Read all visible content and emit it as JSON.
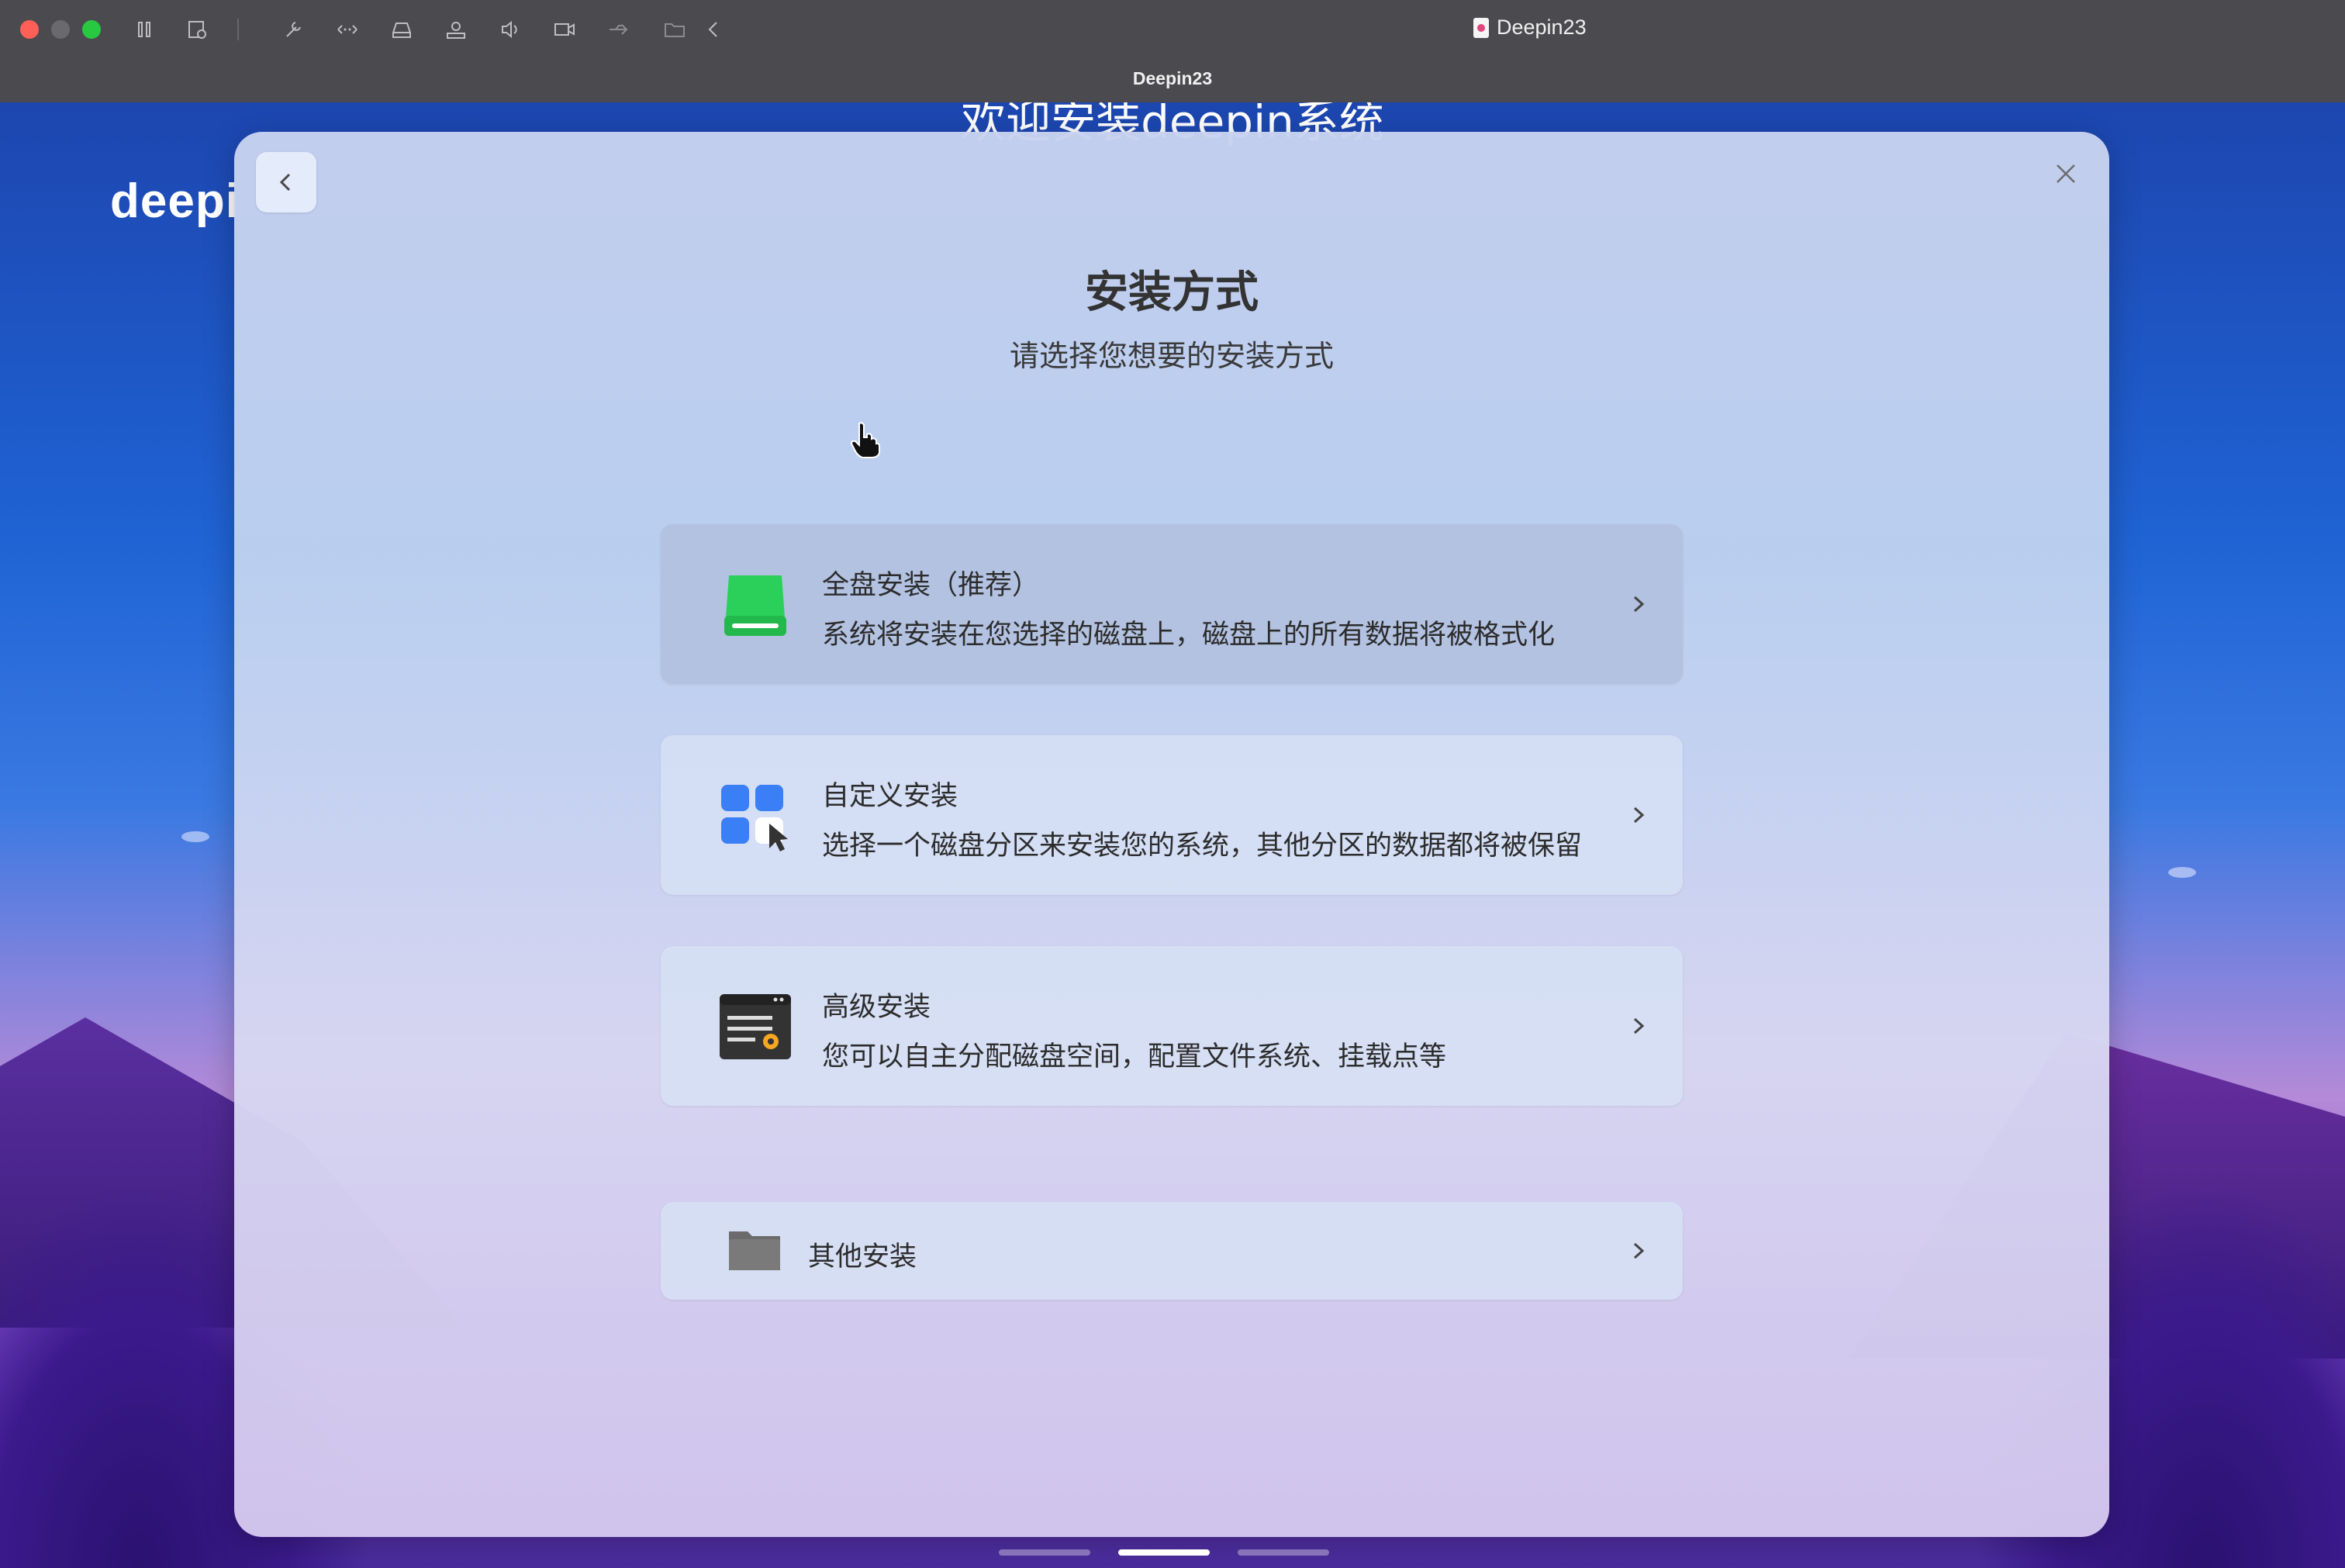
{
  "window": {
    "title": "Deepin23",
    "subtitle": "Deepin23",
    "traffic_colors": {
      "close": "#fe5f57",
      "minimize": "#6a6a6e",
      "zoom": "#28c840"
    }
  },
  "toolbar_icons": [
    "pause-icon",
    "snapshot-icon",
    "wrench-icon",
    "network-icon",
    "disk-icon",
    "printer-icon",
    "sound-icon",
    "camera-icon",
    "usb-icon",
    "shared-folder-icon",
    "chevron-left-icon"
  ],
  "desktop": {
    "brand": "deepi",
    "welcome": "欢迎安装deepin系统"
  },
  "dialog": {
    "title": "安装方式",
    "subtitle": "请选择您想要的安装方式",
    "options": [
      {
        "title": "全盘安装（推荐）",
        "desc": "系统将安装在您选择的磁盘上，磁盘上的所有数据将被格式化",
        "icon": "disk-drive-icon"
      },
      {
        "title": "自定义安装",
        "desc": "选择一个磁盘分区来安装您的系统，其他分区的数据都将被保留",
        "icon": "partition-grid-icon"
      },
      {
        "title": "高级安装",
        "desc": "您可以自主分配磁盘空间，配置文件系统、挂载点等",
        "icon": "advanced-settings-icon"
      },
      {
        "title": "其他安装",
        "icon": "folder-icon"
      }
    ]
  },
  "colors": {
    "accent_green": "#2bd05a",
    "accent_blue": "#3a7ff5",
    "titlebar": "#4b4b4f"
  }
}
